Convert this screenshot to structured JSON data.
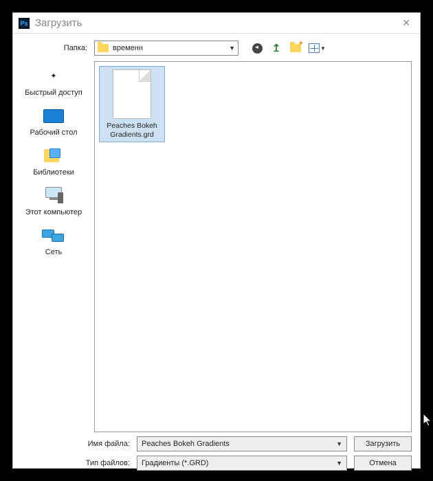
{
  "window": {
    "title": "Загрузить"
  },
  "folder_row": {
    "label": "Папка:",
    "current": "временн"
  },
  "sidebar": {
    "items": [
      {
        "label": "Быстрый доступ"
      },
      {
        "label": "Рабочий стол"
      },
      {
        "label": "Библиотеки"
      },
      {
        "label": "Этот компьютер"
      },
      {
        "label": "Сеть"
      }
    ]
  },
  "files": [
    {
      "name": "Peaches Bokeh Gradients.grd",
      "selected": true
    }
  ],
  "bottom": {
    "filename_label": "Имя файла:",
    "filename_value": "Peaches Bokeh Gradients",
    "filetype_label": "Тип файлов:",
    "filetype_value": "Градиенты (*.GRD)",
    "load_label": "Загрузить",
    "cancel_label": "Отмена"
  }
}
